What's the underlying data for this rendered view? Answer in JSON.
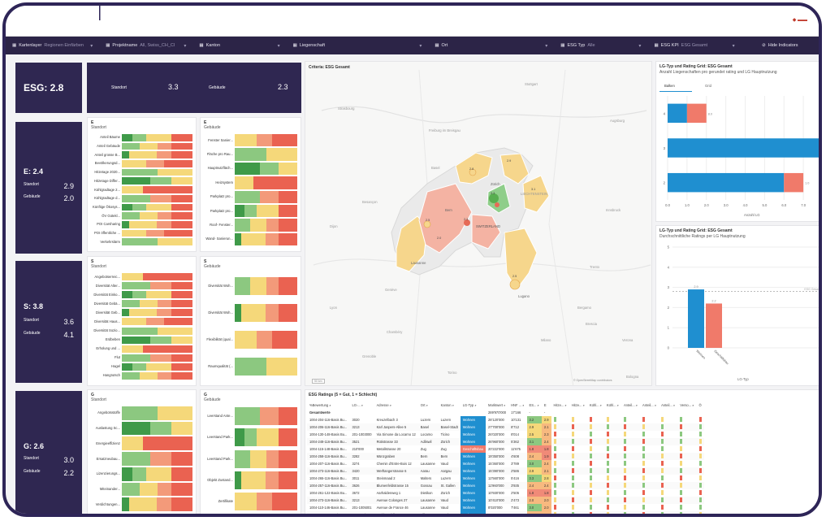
{
  "filters": [
    {
      "icon": "map-icon",
      "label": "Kartenlayer",
      "sub": "Regionen Einfärben"
    },
    {
      "icon": "folder-icon",
      "label": "Projektname",
      "sub": "All, Swiss_CH_CI"
    },
    {
      "icon": "pin-icon",
      "label": "Kanton",
      "sub": ""
    },
    {
      "icon": "building-icon",
      "label": "Liegenschaft",
      "sub": ""
    },
    {
      "icon": "location-icon",
      "label": "Ort",
      "sub": ""
    },
    {
      "icon": "tag-icon",
      "label": "ESG Typ",
      "sub": "Alle"
    },
    {
      "icon": "leaf-icon",
      "label": "ESG KPI",
      "sub": "ESG Gesamt"
    }
  ],
  "hide_indicators": "Hide Indicators",
  "esg_total": "ESG: 2.8",
  "top_kv": [
    {
      "label": "Standort",
      "value": "3.3"
    },
    {
      "label": "Gebäude",
      "value": "2.3"
    }
  ],
  "pillars": [
    {
      "title": "E: 2.4",
      "standort": "2.9",
      "gebaeude": "2.0"
    },
    {
      "title": "S: 3.8",
      "standort": "3.6",
      "gebaeude": "4.1"
    },
    {
      "title": "G: 2.6",
      "standort": "3.0",
      "gebaeude": "2.2"
    }
  ],
  "kv_labels": {
    "standort": "Standort",
    "gebaeude": "Gebäude"
  },
  "panels": {
    "e_standort": {
      "h": "E",
      "sub": "Standort",
      "rows": [
        "Anteil Bäume",
        "Anteil Gebäude",
        "Anteil grosse B...",
        "Bevölkerungsd...",
        "Hitzetage 2020...",
        "Hitzetage Differ...",
        "Kühlgradtage 2...",
        "Kühlgradtage d...",
        "Künftige Ökosys...",
        "ÖV Gütekl...",
        "POI Carsharing",
        "POI öffentliche ...",
        "Verkehrslärm"
      ]
    },
    "e_gebaeude": {
      "h": "E",
      "sub": "Gebäude",
      "rows": [
        "Fenster Sanier...",
        "Fläche pro Rau...",
        "Hauptnutzfläch...",
        "Heizsystem",
        "Parkplatz pro...",
        "Parkplatz pro...",
        "Roof- Fenster...",
        "Wand- Sanierun..."
      ]
    },
    "s_standort": {
      "h": "S",
      "sub": "Standort",
      "rows": [
        "Angebotserreic...",
        "Diversität Alter...",
        "Diversität Einko...",
        "Diversität Gebä...",
        "Diversität Geb...",
        "Diversität Haus...",
        "Diversität Sozio...",
        "Erdbeben",
        "Erholung und ...",
        "Flut",
        "Hagel",
        "Hangrutsch"
      ]
    },
    "s_gebaeude": {
      "h": "S",
      "sub": "Gebäude",
      "rows": [
        "Diversität Woh...",
        "Diversität Woh...",
        "Flexibilität (qual...",
        "Raumqualität (..."
      ]
    },
    "g_standort": {
      "h": "G",
      "sub": "Standort",
      "rows": [
        "Angebotsstoffe",
        "Auslastung Sc...",
        "Energieeffizienz",
        "Ersatzneubau...",
        "Lizenzierungs...",
        "Miteinander...",
        "Verdichtungen..."
      ]
    },
    "g_gebaeude": {
      "h": "G",
      "sub": "Gebäude",
      "rows": [
        "Leerstand Ante...",
        "Leerstand Park...",
        "Leerstand Park...",
        "Objekt Zustand...",
        "Zertifikate"
      ]
    }
  },
  "map": {
    "title": "Criteria: ESG Gesamt",
    "labels": [
      "Freiburg im Breisgau",
      "Basel",
      "Bern",
      "Zürich",
      "LIECHTENSTEIN",
      "SWITZERLAND",
      "Genève",
      "Milano",
      "Lyon",
      "Torino",
      "Bergamo",
      "Verona",
      "Innsbruck",
      "Strasbourg",
      "Stuttgart",
      "Augsburg",
      "Besançon",
      "Dijon",
      "Lausanne",
      "Lugano",
      "Chambéry",
      "Grenoble",
      "Trento",
      "Brescia",
      "Bologna"
    ],
    "values": [
      "2.8",
      "2.5",
      "2.9",
      "3.3",
      "3.1",
      "2.5",
      "2.3",
      "2.0"
    ],
    "attribution": "© OpenStreetMap contributors",
    "scale": "50 km"
  },
  "chart1": {
    "title": "LG-Typ und Rating Grid: ESG Gesamt",
    "subtitle": "Anzahl Liegenschaften pro gerundet rating und LG Hauptnutzung",
    "tabs": [
      "Balken",
      "Grid"
    ],
    "xlabel": "Anzahl LG"
  },
  "chart2": {
    "title": "LG-Typ und Rating Grid: ESG Gesamt",
    "subtitle": "Durchschnittliche Ratings per LG Hauptnutzung",
    "xlabel": "LG-Typ",
    "ref": "ESG Gesamt"
  },
  "chart_data": [
    {
      "type": "bar",
      "orientation": "horizontal",
      "title": "LG-Typ und Rating Grid: ESG Gesamt",
      "xlabel": "Anzahl LG",
      "categories": [
        "4",
        "3",
        "2"
      ],
      "xlim": [
        0,
        8
      ],
      "xticks": [
        "0.0",
        "1.0",
        "2.0",
        "3.0",
        "4.0",
        "5.0",
        "6.0",
        "7.0",
        "8.0"
      ],
      "series": [
        {
          "color": "#1f8fd0",
          "values": [
            1,
            8,
            6
          ]
        },
        {
          "color": "#f07a6a",
          "values": [
            1,
            0,
            1
          ]
        }
      ],
      "data_labels": [
        "1.0",
        "8.0",
        "6.0",
        "1.0",
        "1.0"
      ]
    },
    {
      "type": "bar",
      "title": "LG-Typ und Rating Grid: ESG Gesamt",
      "xlabel": "LG-Typ",
      "categories": [
        "Wohnen",
        "Geschäftsbau"
      ],
      "values": [
        2.9,
        2.2
      ],
      "ylim": [
        0,
        5
      ],
      "yticks": [
        "0",
        "1",
        "2",
        "3",
        "4",
        "5"
      ],
      "colors": [
        "#1f8fd0",
        "#f07a6a"
      ],
      "reference_line": 2.8,
      "data_labels": [
        "2.9",
        "2.2"
      ]
    }
  ],
  "table": {
    "title": "ESG Ratings (5 = Gut, 1 = Schlecht)",
    "headers": [
      "%Bewertung",
      "LG-...",
      "Adresse",
      "Ort",
      "Kanton",
      "LG-Typ",
      "Marktwert",
      "HNF ...",
      "ES...",
      "E",
      "Hitze...",
      "Hitze...",
      "Kühl...",
      "Kühl...",
      "Anteil...",
      "Anteil...",
      "Anteil...",
      "Verso...",
      "Ö"
    ],
    "total_label": "Gesamtwerte",
    "total_values": [
      "289'970'000",
      "17'166",
      "-",
      "-"
    ],
    "rows": [
      [
        "1004-204-116-Basis Bu...",
        "3020",
        "Kreuzelbach 3",
        "Luzern",
        "Luzern",
        "Wohnen",
        "28'120'000",
        "10'131",
        "3.2",
        "2.9"
      ],
      [
        "1004-206-116-Basis Bu...",
        "3213",
        "Karl Jaspers-Allee 5",
        "Basel",
        "Basel-Stadt",
        "Wohnen",
        "27'700'000",
        "8'712",
        "2.9",
        "2.1"
      ],
      [
        "1004-130-148-Basis Bu...",
        "201-1003000",
        "Via Simone da Locarno 12",
        "Locarno",
        "Ticino",
        "Wohnen",
        "26'020'000",
        "8'014",
        "2.5",
        "2.3"
      ],
      [
        "1004-248-116-Basis Bu...",
        "3521",
        "Rütistrasse 33",
        "Adliswil",
        "Zürich",
        "Wohnen",
        "26'960'000",
        "5'362",
        "3.1",
        "2.4"
      ],
      [
        "1004-115-148-Basis Bu...",
        "210'000",
        "Metallstrasse 20",
        "Zug",
        "Zug",
        "Geschäftsbau",
        "20'222'000",
        "11'675",
        "1.8",
        "1.8"
      ],
      [
        "1004-258-116-Basis Bu...",
        "3282",
        "Münzgraben",
        "Bern",
        "Bern",
        "Wohnen",
        "19'350'000",
        "4'608",
        "2.4",
        "1.9"
      ],
      [
        "1004-207-116-Basis Bu...",
        "3274",
        "Chemin d'Entre-Bois 12",
        "Lausanne",
        "Vaud",
        "Wohnen",
        "15'360'000",
        "3'789",
        "3.0",
        "2.4"
      ],
      [
        "1004-273-116-Basis Bu...",
        "3420",
        "Werftangerstrasse 6",
        "Aarau",
        "Aargau",
        "Wohnen",
        "15'390'000",
        "2'586",
        "2.9",
        "2.1"
      ],
      [
        "1004-265-116-Basis Bu...",
        "3011",
        "Steinmaad 2",
        "Malters",
        "Luzern",
        "Wohnen",
        "12'560'000",
        "5'416",
        "3.3",
        "2.8"
      ],
      [
        "1004-257-116-Basis Bu...",
        "3626",
        "Blumenfeldstrasse 15",
        "Gossau",
        "St. Gallen",
        "Wohnen",
        "11'960'000",
        "3'935",
        "2.4",
        "2.4"
      ],
      [
        "1004-261-122-Basis Bu...",
        "3672",
        "Aarhaldenweg 1",
        "Dietikon",
        "Zürich",
        "Wohnen",
        "10'930'000",
        "2'505",
        "1.8",
        "1.8"
      ],
      [
        "1004-273-116-Basis Bu...",
        "3213",
        "Avenue Colonges 27",
        "Lausanne",
        "Vaud",
        "Wohnen",
        "10'410'000",
        "2'473",
        "2.0",
        "2.0"
      ],
      [
        "1004-110-146-Basis Bu...",
        "201-1005001",
        "Avenue de France 46",
        "Lausanne",
        "Vaud",
        "Wohnen",
        "8'020'000",
        "7'461",
        "3.0",
        "2.0"
      ],
      [
        "1004-252-121-Basis Bu...",
        "33398-Vitr...",
        "Stalden Château 1",
        "Villeneuve",
        "Vaud",
        "Wohnen",
        "8'013'000",
        "2'468",
        "2.4",
        "2.2"
      ],
      [
        "1004-105-148-Basis Bu...",
        "201'000'000",
        "Landskronstrasse 4",
        "Basel",
        "Basel-Stadt",
        "Wohnen",
        "7'618'000",
        "3'211",
        "2.1",
        "1.8"
      ]
    ]
  }
}
